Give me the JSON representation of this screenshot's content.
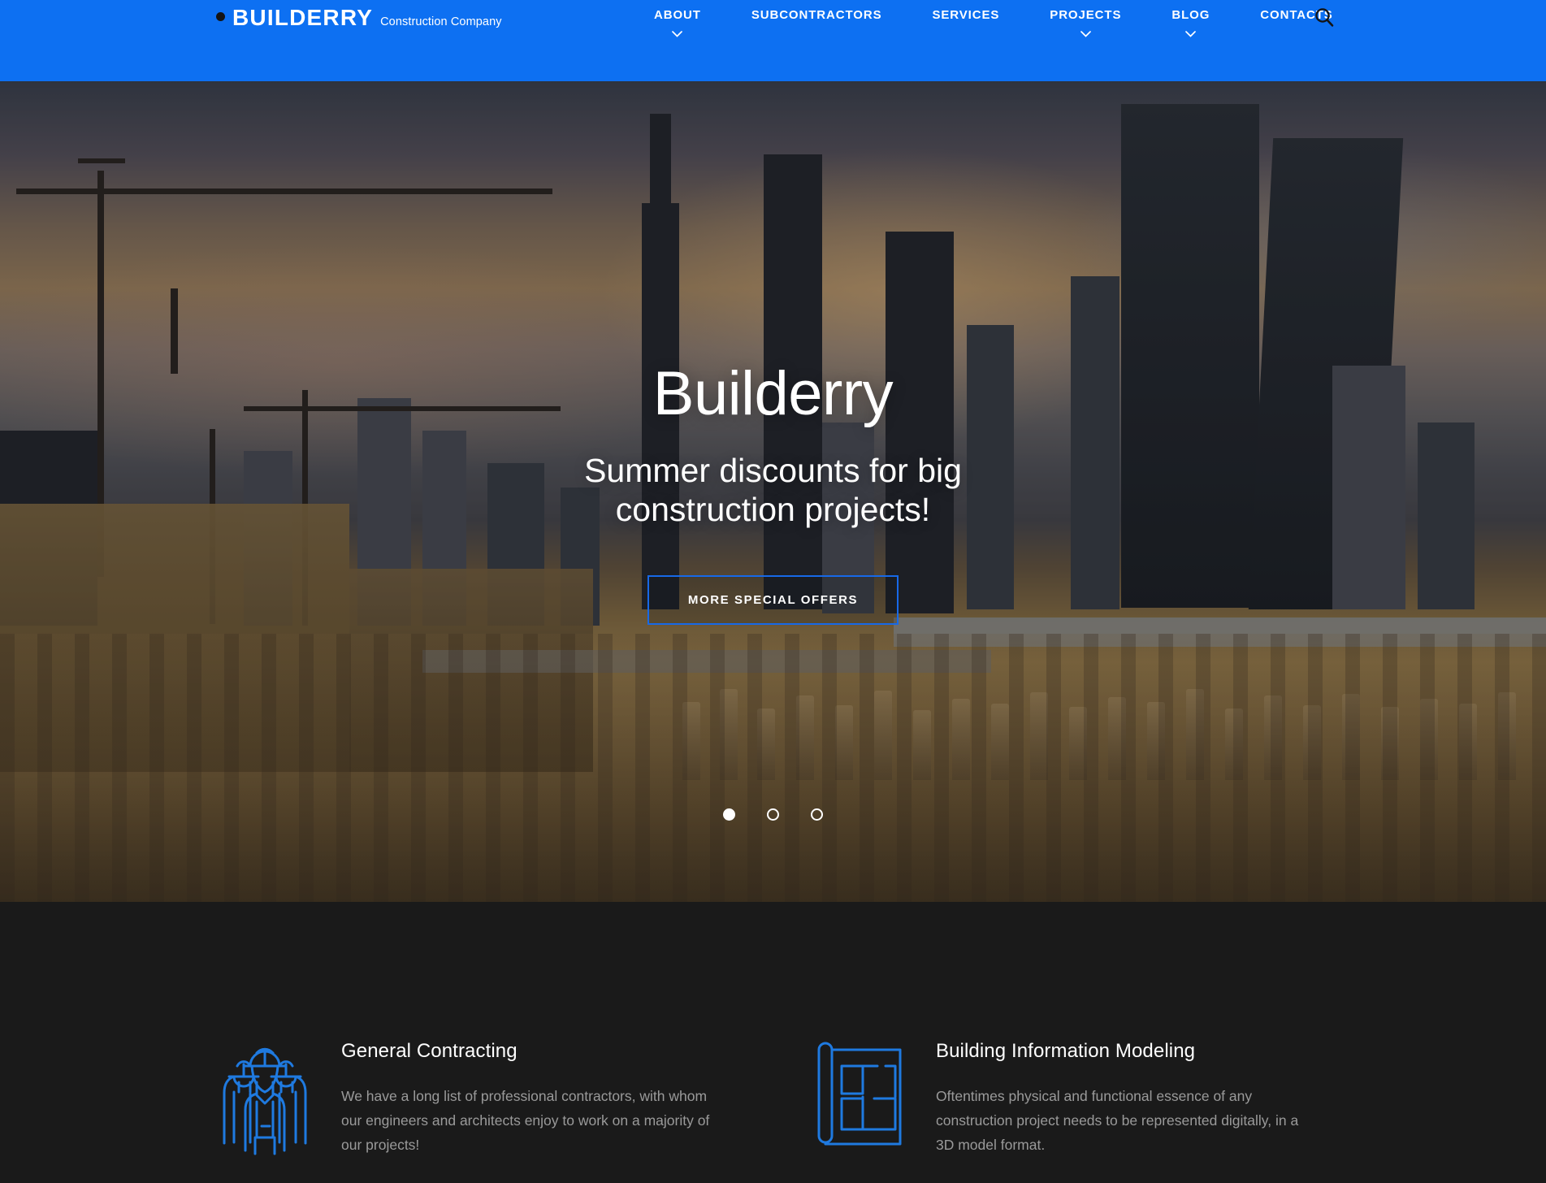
{
  "header": {
    "brand": {
      "dot_icon": "bullet-dot-icon",
      "name": "BUILDERRY",
      "tagline": "Construction Company"
    },
    "nav": [
      {
        "label": "ABOUT",
        "has_dropdown": true
      },
      {
        "label": "SUBCONTRACTORS",
        "has_dropdown": false
      },
      {
        "label": "SERVICES",
        "has_dropdown": false
      },
      {
        "label": "PROJECTS",
        "has_dropdown": true
      },
      {
        "label": "BLOG",
        "has_dropdown": true
      },
      {
        "label": "CONTACTS",
        "has_dropdown": false
      }
    ],
    "search_icon": "search-icon",
    "background_color": "#0d70f2"
  },
  "hero": {
    "title": "Builderry",
    "subtitle_line1": "Summer discounts for big",
    "subtitle_line2": "construction projects!",
    "cta_label": "MORE SPECIAL OFFERS",
    "cta_border_color": "#1769e8",
    "slides": [
      {
        "index": 1,
        "active": true
      },
      {
        "index": 2,
        "active": false
      },
      {
        "index": 3,
        "active": false
      }
    ]
  },
  "services": {
    "background_color": "#1a1a1a",
    "accent_color": "#1f7ae0",
    "cards": [
      {
        "icon": "construction-workers-icon",
        "title": "General Contracting",
        "body": "We have a long list of professional contractors, with whom our engineers and architects enjoy to work on a majority of our projects!"
      },
      {
        "icon": "blueprint-floorplan-icon",
        "title": "Building Information Modeling",
        "body": "Oftentimes physical and functional essence of any construction project needs to be represented digitally, in a 3D model format."
      }
    ]
  }
}
